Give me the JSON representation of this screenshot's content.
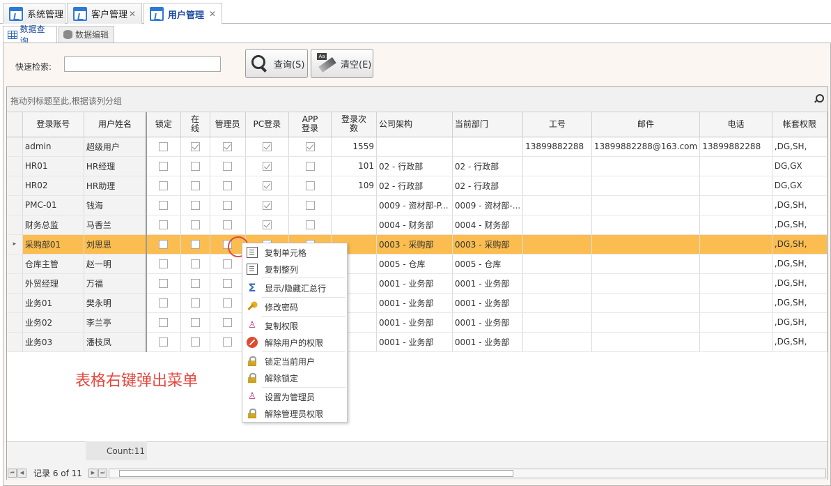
{
  "top_tabs": [
    {
      "label": "系统管理"
    },
    {
      "label": "客户管理"
    },
    {
      "label": "用户管理"
    }
  ],
  "sub_tabs": [
    {
      "label": "数据查询"
    },
    {
      "label": "数据编辑"
    }
  ],
  "search": {
    "label": "快速检索:",
    "value": "",
    "query_button": "查询(S)",
    "clear_button": "清空(E)",
    "clear_icon_text": "Aa"
  },
  "grid": {
    "group_panel": "拖动列标题至此,根据该列分组",
    "columns": [
      "登录账号",
      "用户姓名",
      "锁定",
      "在线",
      "管理员",
      "PC登录",
      "APP登录",
      "登录次数",
      "公司架构",
      "当前部门",
      "工号",
      "邮件",
      "电话",
      "帐套权限"
    ],
    "rows": [
      {
        "account": "admin",
        "name": "超级用户",
        "locked": false,
        "online": true,
        "admin": true,
        "pc": true,
        "app": true,
        "logins": "1559",
        "company": "",
        "dept": "",
        "empno": "13899882288",
        "email": "13899882288@163.com",
        "phone": "13899882288",
        "perm": ",DG,SH,"
      },
      {
        "account": "HR01",
        "name": "HR经理",
        "locked": false,
        "online": false,
        "admin": false,
        "pc": true,
        "app": false,
        "logins": "101",
        "company": "02 - 行政部",
        "dept": "02 - 行政部",
        "empno": "",
        "email": "",
        "phone": "",
        "perm": "DG,GX"
      },
      {
        "account": "HR02",
        "name": "HR助理",
        "locked": false,
        "online": false,
        "admin": false,
        "pc": true,
        "app": false,
        "logins": "109",
        "company": "02 - 行政部",
        "dept": "02 - 行政部",
        "empno": "",
        "email": "",
        "phone": "",
        "perm": "DG,GX"
      },
      {
        "account": "PMC-01",
        "name": "钱海",
        "locked": false,
        "online": false,
        "admin": false,
        "pc": true,
        "app": false,
        "logins": "",
        "company": "0009 - 资材部-P...",
        "dept": "0009 - 资材部-...",
        "empno": "",
        "email": "",
        "phone": "",
        "perm": ",DG,SH,"
      },
      {
        "account": "财务总监",
        "name": "马香兰",
        "locked": false,
        "online": false,
        "admin": false,
        "pc": true,
        "app": false,
        "logins": "",
        "company": "0004 - 财务部",
        "dept": "0004 - 财务部",
        "empno": "",
        "email": "",
        "phone": "",
        "perm": ",DG,SH,"
      },
      {
        "account": "采购部01",
        "name": "刘思思",
        "locked": false,
        "online": false,
        "admin": false,
        "pc": true,
        "app": false,
        "logins": "",
        "company": "0003 - 采购部",
        "dept": "0003 - 采购部",
        "empno": "",
        "email": "",
        "phone": "",
        "perm": ",DG,SH,",
        "selected": true
      },
      {
        "account": "仓库主管",
        "name": "赵一明",
        "locked": false,
        "online": false,
        "admin": false,
        "pc": false,
        "app": false,
        "logins": "",
        "company": "0005 - 仓库",
        "dept": "0005 - 仓库",
        "empno": "",
        "email": "",
        "phone": "",
        "perm": ",DG,SH,"
      },
      {
        "account": "外贸经理",
        "name": "万福",
        "locked": false,
        "online": false,
        "admin": false,
        "pc": false,
        "app": false,
        "logins": "",
        "company": "0001 - 业务部",
        "dept": "0001 - 业务部",
        "empno": "",
        "email": "",
        "phone": "",
        "perm": ",DG,SH,"
      },
      {
        "account": "业务01",
        "name": "樊永明",
        "locked": false,
        "online": false,
        "admin": false,
        "pc": false,
        "app": false,
        "logins": "",
        "company": "0001 - 业务部",
        "dept": "0001 - 业务部",
        "empno": "",
        "email": "",
        "phone": "",
        "perm": ",DG,SH,"
      },
      {
        "account": "业务02",
        "name": "李兰亭",
        "locked": false,
        "online": false,
        "admin": false,
        "pc": false,
        "app": false,
        "logins": "",
        "company": "0001 - 业务部",
        "dept": "0001 - 业务部",
        "empno": "",
        "email": "",
        "phone": "",
        "perm": ",DG,SH,"
      },
      {
        "account": "业务03",
        "name": "潘枝凤",
        "locked": false,
        "online": false,
        "admin": false,
        "pc": false,
        "app": false,
        "logins": "",
        "company": "0001 - 业务部",
        "dept": "0001 - 业务部",
        "empno": "",
        "email": "",
        "phone": "",
        "perm": ",DG,SH,"
      }
    ],
    "count": "Count:11",
    "record": "记录 6 of 11"
  },
  "context_menu": [
    {
      "label": "复制单元格",
      "icon": "copy-icon"
    },
    {
      "label": "复制整列",
      "icon": "copy-icon"
    },
    {
      "label": "显示/隐藏汇总行",
      "icon": "sum-icon"
    },
    {
      "label": "修改密码",
      "icon": "key-icon"
    },
    {
      "label": "复制权限",
      "icon": "user-icon"
    },
    {
      "label": "解除用户的权限",
      "icon": "forbid-icon"
    },
    {
      "label": "锁定当前用户",
      "icon": "lock-icon"
    },
    {
      "label": "解除锁定",
      "icon": "unlock-icon"
    },
    {
      "label": "设置为管理员",
      "icon": "user-icon"
    },
    {
      "label": "解除管理员权限",
      "icon": "unlock-icon"
    }
  ],
  "annotation": "表格右键弹出菜单",
  "colors": {
    "selected_row": "#fbbd4f",
    "annotation": "#e8453c",
    "accent": "#2f7ad6"
  }
}
